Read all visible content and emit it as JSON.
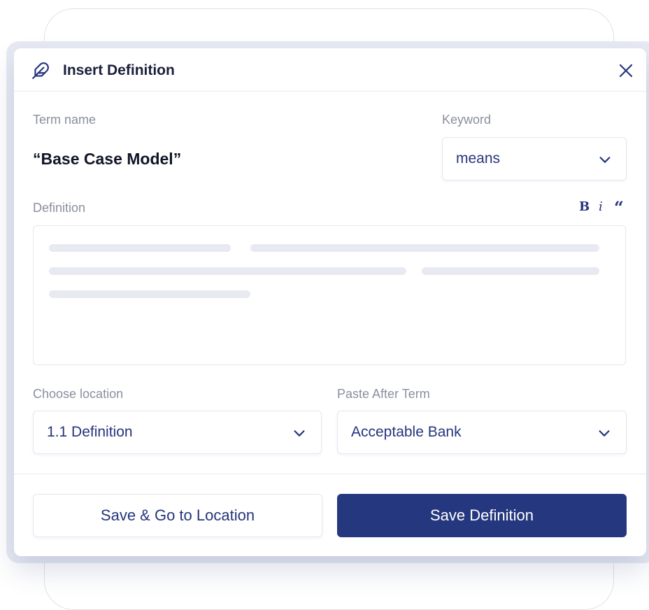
{
  "dialog": {
    "title": "Insert Definition",
    "header_icon": "feather-icon",
    "close_icon": "close-icon"
  },
  "term": {
    "label": "Term name",
    "value": "“Base Case Model”"
  },
  "keyword": {
    "label": "Keyword",
    "value": "means"
  },
  "definition": {
    "label": "Definition",
    "format": {
      "bold": "B",
      "italic": "i",
      "quote": "“"
    }
  },
  "location": {
    "label": "Choose location",
    "value": "1.1 Definition"
  },
  "paste_after": {
    "label": "Paste After Term",
    "value": "Acceptable Bank"
  },
  "actions": {
    "secondary": "Save & Go to Location",
    "primary": "Save Definition"
  },
  "colors": {
    "accent": "#25377e",
    "title": "#1b1f3b",
    "label": "#8a8f9e",
    "placeholder": "#e8eaf1"
  }
}
